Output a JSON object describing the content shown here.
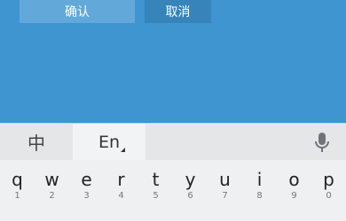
{
  "dialog": {
    "confirm_label": "确认",
    "cancel_label": "取消"
  },
  "ime": {
    "chinese_label": "中",
    "english_label": "En",
    "mic_icon": "microphone-icon"
  },
  "keyboard": {
    "row1": [
      {
        "char": "q",
        "num": "1"
      },
      {
        "char": "w",
        "num": "2"
      },
      {
        "char": "e",
        "num": "3"
      },
      {
        "char": "r",
        "num": "4"
      },
      {
        "char": "t",
        "num": "5"
      },
      {
        "char": "y",
        "num": "6"
      },
      {
        "char": "u",
        "num": "7"
      },
      {
        "char": "i",
        "num": "8"
      },
      {
        "char": "o",
        "num": "9"
      },
      {
        "char": "p",
        "num": "0"
      }
    ]
  },
  "colors": {
    "background": "#3f95cf",
    "confirm_button": "#62a9da",
    "cancel_button": "#3784bb",
    "ime_bar": "#e4e6e8",
    "keyboard": "#eef0f1"
  }
}
